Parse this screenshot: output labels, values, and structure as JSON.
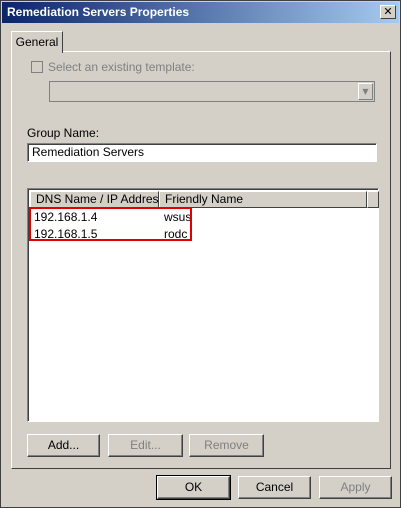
{
  "window": {
    "title": "Remediation Servers Properties",
    "close_glyph": "✕"
  },
  "tabs": [
    {
      "label": "General"
    }
  ],
  "template": {
    "checkbox_label": "Select an existing template:",
    "checked": false,
    "combo_value": "",
    "combo_arrow_glyph": "▼"
  },
  "group": {
    "label": "Group Name:",
    "value": "Remediation Servers"
  },
  "list": {
    "columns": [
      "DNS Name / IP Address",
      "Friendly Name"
    ],
    "rows": [
      {
        "address": "192.168.1.4",
        "name": "wsus"
      },
      {
        "address": "192.168.1.5",
        "name": "rodc"
      }
    ]
  },
  "list_buttons": {
    "add": "Add...",
    "edit": "Edit...",
    "remove": "Remove"
  },
  "footer": {
    "ok": "OK",
    "cancel": "Cancel",
    "apply": "Apply"
  },
  "colors": {
    "title_bar_start": "#0a246a",
    "title_bar_end": "#a6caf0",
    "dialog_face": "#d4d0c8",
    "highlight_box": "#e00000"
  }
}
